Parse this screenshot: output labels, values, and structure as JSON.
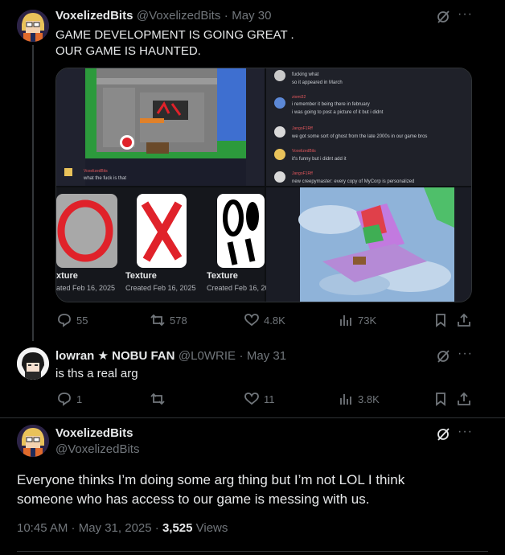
{
  "post1": {
    "display_name": "VoxelizedBits",
    "handle": "@VoxelizedBits",
    "date": "May 30",
    "text_line1": "GAME DEVELOPMENT IS GOING GREAT .",
    "text_line2": "OUR GAME IS HAUNTED.",
    "stats": {
      "replies": "55",
      "reposts": "578",
      "likes": "4.8K",
      "views": "73K"
    },
    "media": {
      "chat_top": [
        {
          "name": "",
          "lines": [
            "fucking what",
            "so it appeared in March"
          ]
        },
        {
          "name": "ziomi32",
          "lines": [
            "i remember it being there in february",
            "i was going to post a picture of it but i didnt"
          ]
        },
        {
          "name": "JangoF1Rff",
          "lines": [
            "we got some sort of ghost from the late 2000s in our game bros"
          ]
        },
        {
          "name": "VoxelizedBits",
          "lines": [
            "it's funny but i didnt add it"
          ]
        },
        {
          "name": "JangoF1Rff",
          "lines": [
            "new creepymaster: every copy of MyCorp is personalized"
          ]
        }
      ],
      "game_chat_name": "VoxelizedBits",
      "game_chat_text": "what the fuck is that",
      "texture_cards": [
        {
          "title": "xture",
          "created": "ated Feb 16, 2025"
        },
        {
          "title": "Texture",
          "created": "Created Feb 16, 2025"
        },
        {
          "title": "Texture",
          "created": "Created Feb 16, 202"
        }
      ]
    }
  },
  "post2": {
    "display_name": "lowran ★ NOBU FAN",
    "handle": "@L0WRIE",
    "date": "May 31",
    "text": "is ths a real arg",
    "stats": {
      "replies": "1",
      "reposts": "",
      "likes": "11",
      "views": "3.8K"
    }
  },
  "post3": {
    "display_name": "VoxelizedBits",
    "handle": "@VoxelizedBits",
    "text_line1": "Everyone thinks I’m doing some arg thing but I’m not LOL I think",
    "text_line2": "someone who has access to our game is messing with us.",
    "timestamp": "10:45 AM · May 31, 2025 · ",
    "views_count": "3,525",
    "views_label": " Views"
  },
  "colors": {
    "background": "#000000",
    "text": "#e7e9ea",
    "muted": "#71767b",
    "border": "#2f3336"
  },
  "icons": [
    "grok-icon",
    "more-icon",
    "reply-icon",
    "repost-icon",
    "like-icon",
    "views-icon",
    "bookmark-icon",
    "share-icon"
  ]
}
